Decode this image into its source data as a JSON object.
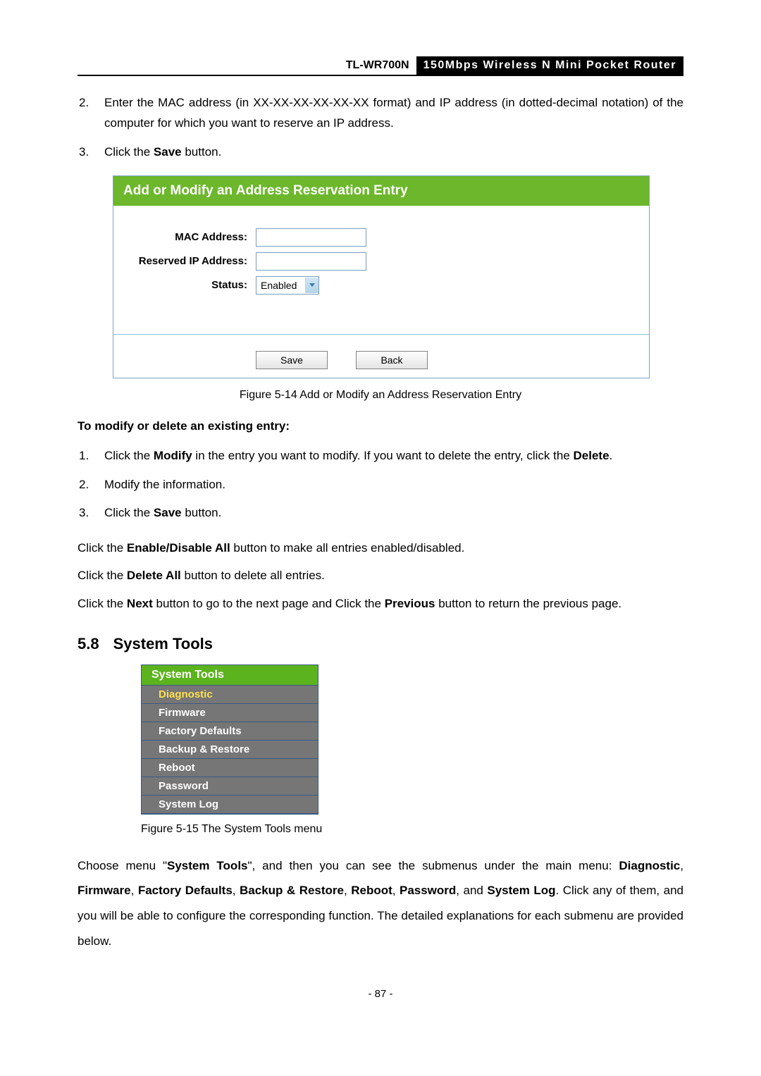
{
  "header": {
    "model": "TL-WR700N",
    "desc": "150Mbps Wireless N Mini Pocket Router"
  },
  "top_list": {
    "item2_num": "2.",
    "item2_text": "Enter the MAC address (in XX-XX-XX-XX-XX-XX format) and IP address (in dotted-decimal notation) of the computer for which you want to reserve an IP address.",
    "item3_num": "3.",
    "item3_text_a": "Click the ",
    "item3_text_b": "Save",
    "item3_text_c": " button."
  },
  "figure14": {
    "title": "Add or Modify an Address Reservation Entry",
    "mac_label": "MAC Address:",
    "ip_label": "Reserved IP Address:",
    "status_label": "Status:",
    "status_value": "Enabled",
    "save_btn": "Save",
    "back_btn": "Back",
    "caption": "Figure 5-14    Add or Modify an Address Reservation Entry"
  },
  "modify_section": {
    "heading": "To modify or delete an existing entry:",
    "item1_num": "1.",
    "item1_a": "Click the ",
    "item1_b": "Modify",
    "item1_c": " in the entry you want to modify. If you want to delete the entry, click the ",
    "item1_d": "Delete",
    "item1_e": ".",
    "item2_num": "2.",
    "item2_text": "Modify the information.",
    "item3_num": "3.",
    "item3_a": "Click the ",
    "item3_b": "Save",
    "item3_c": " button."
  },
  "paras": {
    "p1_a": "Click the ",
    "p1_b": "Enable/Disable All",
    "p1_c": " button to make all entries enabled/disabled.",
    "p2_a": "Click the ",
    "p2_b": "Delete All",
    "p2_c": " button to delete all entries.",
    "p3_a": "Click the ",
    "p3_b": "Next",
    "p3_c": " button to go to the next page and Click the ",
    "p3_d": "Previous",
    "p3_e": " button to return the previous page."
  },
  "section58": {
    "num": "5.8",
    "title": "System Tools"
  },
  "menu": {
    "title": "System Tools",
    "items": [
      "Diagnostic",
      "Firmware",
      "Factory Defaults",
      "Backup & Restore",
      "Reboot",
      "Password",
      "System Log"
    ],
    "caption": "Figure 5-15 The System Tools menu"
  },
  "bottom_para": {
    "a": "Choose menu \"",
    "b": "System Tools",
    "c": "\", and then you can see the submenus under the main menu: ",
    "d": "Diagnostic",
    "e": ", ",
    "f": "Firmware",
    "g": ", ",
    "h": "Factory Defaults",
    "i": ", ",
    "j": "Backup & Restore",
    "k": ", ",
    "l": "Reboot",
    "m": ", ",
    "n": "Password",
    "o": ", and ",
    "p": "System Log",
    "q": ". Click any of them, and you will be able to configure the corresponding function. The detailed explanations for each submenu are provided below."
  },
  "page_number": "- 87 -"
}
